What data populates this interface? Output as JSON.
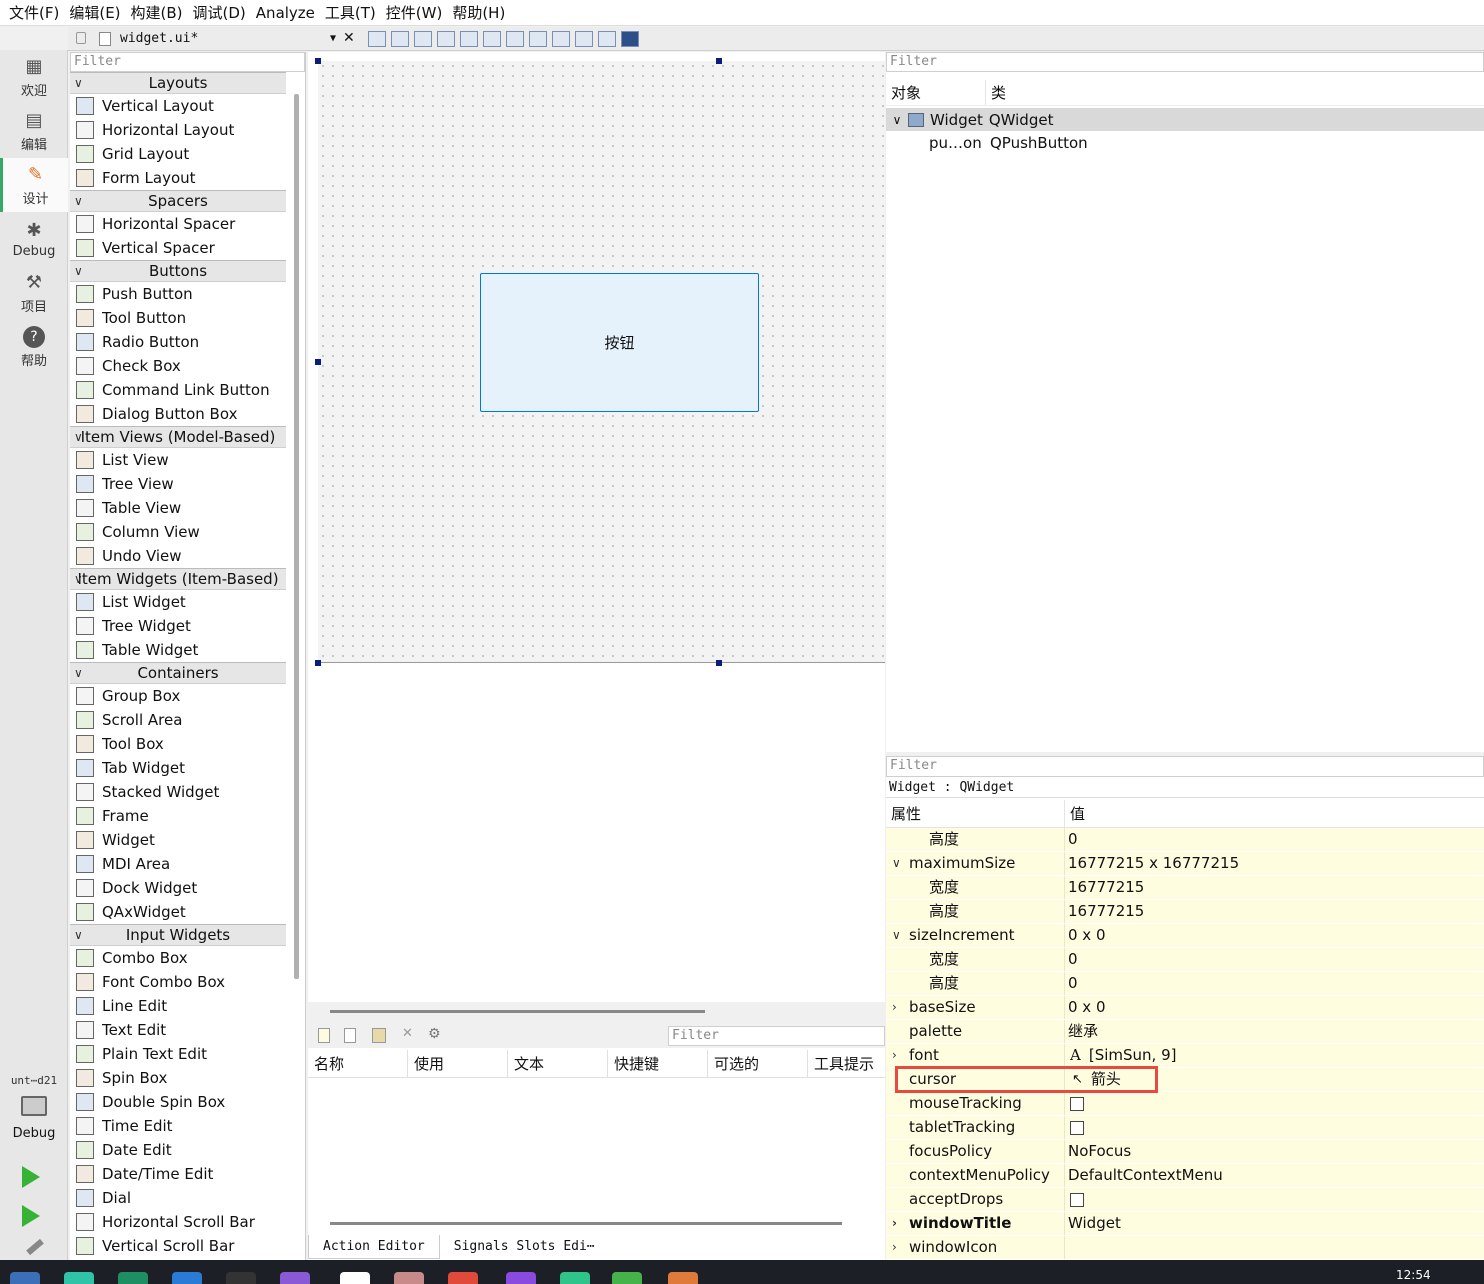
{
  "menu": [
    "文件(F)",
    "编辑(E)",
    "构建(B)",
    "调试(D)",
    "Analyze",
    "工具(T)",
    "控件(W)",
    "帮助(H)"
  ],
  "modes": [
    {
      "label": "欢迎",
      "icon": "grid-icon"
    },
    {
      "label": "编辑",
      "icon": "document-icon"
    },
    {
      "label": "设计",
      "icon": "pencil-icon"
    },
    {
      "label": "Debug",
      "icon": "bug-icon"
    },
    {
      "label": "项目",
      "icon": "wrench-icon"
    },
    {
      "label": "帮助",
      "icon": "help-icon"
    }
  ],
  "kit": {
    "name": "unt⋯d21",
    "mode": "Debug"
  },
  "editor": {
    "file": "widget.ui*"
  },
  "widgetbox": {
    "filter_placeholder": "Filter",
    "categories": [
      {
        "name": "Layouts",
        "items": [
          "Vertical Layout",
          "Horizontal Layout",
          "Grid Layout",
          "Form Layout"
        ]
      },
      {
        "name": "Spacers",
        "items": [
          "Horizontal Spacer",
          "Vertical Spacer"
        ]
      },
      {
        "name": "Buttons",
        "items": [
          "Push Button",
          "Tool Button",
          "Radio Button",
          "Check Box",
          "Command Link Button",
          "Dialog Button Box"
        ]
      },
      {
        "name": "Item Views (Model-Based)",
        "items": [
          "List View",
          "Tree View",
          "Table View",
          "Column View",
          "Undo View"
        ]
      },
      {
        "name": "Item Widgets (Item-Based)",
        "items": [
          "List Widget",
          "Tree Widget",
          "Table Widget"
        ]
      },
      {
        "name": "Containers",
        "items": [
          "Group Box",
          "Scroll Area",
          "Tool Box",
          "Tab Widget",
          "Stacked Widget",
          "Frame",
          "Widget",
          "MDI Area",
          "Dock Widget",
          "QAxWidget"
        ]
      },
      {
        "name": "Input Widgets",
        "items": [
          "Combo Box",
          "Font Combo Box",
          "Line Edit",
          "Text Edit",
          "Plain Text Edit",
          "Spin Box",
          "Double Spin Box",
          "Time Edit",
          "Date Edit",
          "Date/Time Edit",
          "Dial",
          "Horizontal Scroll Bar",
          "Vertical Scroll Bar"
        ]
      }
    ]
  },
  "form": {
    "button_text": "按钮"
  },
  "action_editor": {
    "filter_placeholder": "Filter",
    "columns": [
      "名称",
      "使用",
      "文本",
      "快捷键",
      "可选的",
      "工具提示"
    ],
    "tabs": [
      "Action Editor",
      "Signals  Slots Edi⋯"
    ]
  },
  "object_inspector": {
    "filter_placeholder": "Filter",
    "columns": [
      "对象",
      "类"
    ],
    "rows": [
      {
        "object": "Widget",
        "class": "QWidget"
      },
      {
        "object": "pu…on",
        "class": "QPushButton"
      }
    ]
  },
  "property_editor": {
    "filter_placeholder": "Filter",
    "caption": "Widget : QWidget",
    "columns": [
      "属性",
      "值"
    ],
    "rows": [
      {
        "name": "高度",
        "value": "0",
        "sub": true
      },
      {
        "name": "maximumSize",
        "value": "16777215 x 16777215",
        "expand": "v"
      },
      {
        "name": "宽度",
        "value": "16777215",
        "sub": true
      },
      {
        "name": "高度",
        "value": "16777215",
        "sub": true
      },
      {
        "name": "sizeIncrement",
        "value": "0 x 0",
        "expand": "v"
      },
      {
        "name": "宽度",
        "value": "0",
        "sub": true
      },
      {
        "name": "高度",
        "value": "0",
        "sub": true
      },
      {
        "name": "baseSize",
        "value": "0 x 0",
        "expand": ">"
      },
      {
        "name": "palette",
        "value": "继承"
      },
      {
        "name": "font",
        "value": "[SimSun, 9]",
        "expand": ">",
        "icon": "A"
      },
      {
        "name": "cursor",
        "value": "箭头",
        "icon": "arrow-cursor"
      },
      {
        "name": "mouseTracking",
        "checkbox": true
      },
      {
        "name": "tabletTracking",
        "checkbox": true
      },
      {
        "name": "focusPolicy",
        "value": "NoFocus"
      },
      {
        "name": "contextMenuPolicy",
        "value": "DefaultContextMenu"
      },
      {
        "name": "acceptDrops",
        "checkbox": true
      },
      {
        "name": "windowTitle",
        "value": "Widget",
        "expand": ">",
        "bold": true
      },
      {
        "name": "windowIcon",
        "value": "",
        "expand": ">"
      }
    ]
  },
  "taskbar": {
    "time": "12:54"
  }
}
